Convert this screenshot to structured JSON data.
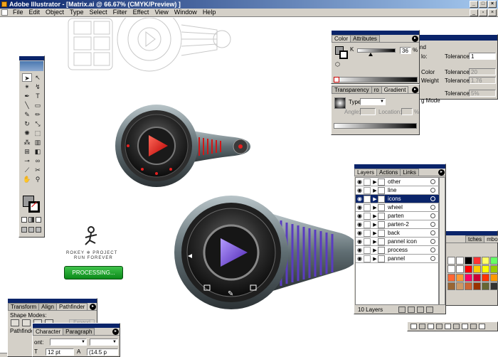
{
  "window": {
    "title": "Adobe Illustrator - [Matrix.ai @ 66.67% (CMYK/Preview) ]"
  },
  "menu": [
    "File",
    "Edit",
    "Object",
    "Type",
    "Select",
    "Filter",
    "Effect",
    "View",
    "Window",
    "Help"
  ],
  "color_panel": {
    "tabs": [
      "Color",
      "Attributes"
    ],
    "channel": "K",
    "value": "36",
    "unit": "%"
  },
  "stroke_panel": {
    "labels": [
      "lo:",
      "Color",
      "Weight",
      "g Mode"
    ],
    "fields": [
      {
        "label": "Tolerance",
        "value": "1"
      },
      {
        "label": "Tolerance",
        "value": "20"
      },
      {
        "label": "Tolerance",
        "value": "1.76"
      },
      {
        "label": "Tolerance",
        "value": "5%"
      }
    ],
    "tab_fragment": "nd"
  },
  "gradient_panel": {
    "tabs": [
      "Transparency",
      "ro",
      "Gradient"
    ],
    "type_label": "Type:",
    "angle_label": "Angle:",
    "location_label": "Location:",
    "pct": "%"
  },
  "layers_panel": {
    "tabs": [
      "Layers",
      "Actions",
      "Links"
    ],
    "layers": [
      "other",
      "line",
      "icons",
      "wheel",
      "parten",
      "parten-2",
      "back",
      "pannel icon",
      "process",
      "pannel"
    ],
    "selected_index": 2,
    "footer": "10 Layers"
  },
  "swatches_panel": {
    "tabs": [
      "tches",
      "mbols"
    ],
    "colors": [
      "#ffffff",
      "#ffffff",
      "#000000",
      "#ff3333",
      "#ffff66",
      "#66ff66",
      "#ffffff",
      "#ffffff",
      "#ff0000",
      "#ffcc00",
      "#ffff00",
      "#99cc00",
      "#ff6633",
      "#ff9933",
      "#ff0066",
      "#cc0033",
      "#ff3300",
      "#ff9900",
      "#996633",
      "#cc9966",
      "#cc6633",
      "#993300",
      "#666633",
      "#333333"
    ]
  },
  "pathfinder_panel": {
    "tabs": [
      "Transform",
      "Align",
      "Pathfinder"
    ],
    "shape_modes": "Shape Modes:",
    "pathfinders": "Pathfinde",
    "expand": "Expand"
  },
  "character_panel": {
    "tabs": [
      "Character",
      "Paragraph"
    ],
    "font_label": "ont:",
    "size": "12 pt",
    "leading": "(14.5 p"
  },
  "artwork": {
    "brand_line1": "ROKEY ✲ PROJECT",
    "brand_line2": "RUN FOREVER",
    "processing": "PROCESSING..."
  },
  "colors": {
    "title_blue": "#0a246a",
    "panel_gray": "#d4d0c8",
    "play_red": "#e01010",
    "play_purple": "#6a3fd0"
  }
}
